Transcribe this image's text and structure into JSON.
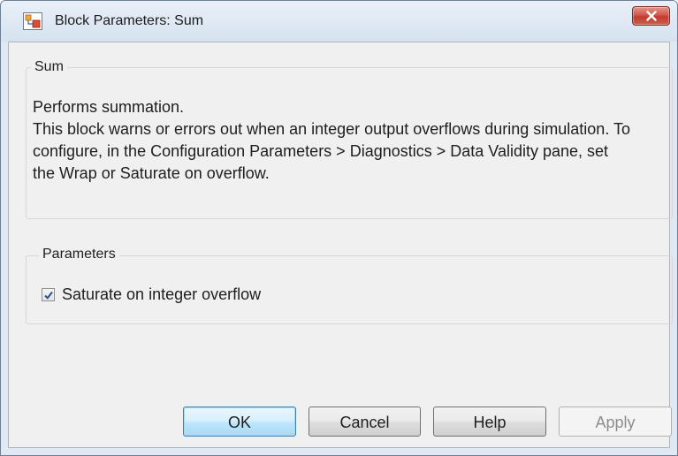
{
  "window": {
    "title": "Block Parameters: Sum",
    "app_icon": "simulink-block-icon",
    "close_icon": "close-icon",
    "close_color": "#c7463a"
  },
  "block_group": {
    "title": "Sum",
    "description_lines": [
      "Performs summation.",
      "This block warns or errors out when an integer output overflows during simulation. To configure, in the Configuration Parameters > Diagnostics > Data Validity pane, set the Wrap or Saturate on overflow."
    ]
  },
  "parameters_group": {
    "title": "Parameters",
    "saturate_checkbox": {
      "label": "Saturate on integer overflow",
      "checked": true
    }
  },
  "buttons": {
    "ok": "OK",
    "cancel": "Cancel",
    "help": "Help",
    "apply": "Apply",
    "apply_enabled": false
  }
}
